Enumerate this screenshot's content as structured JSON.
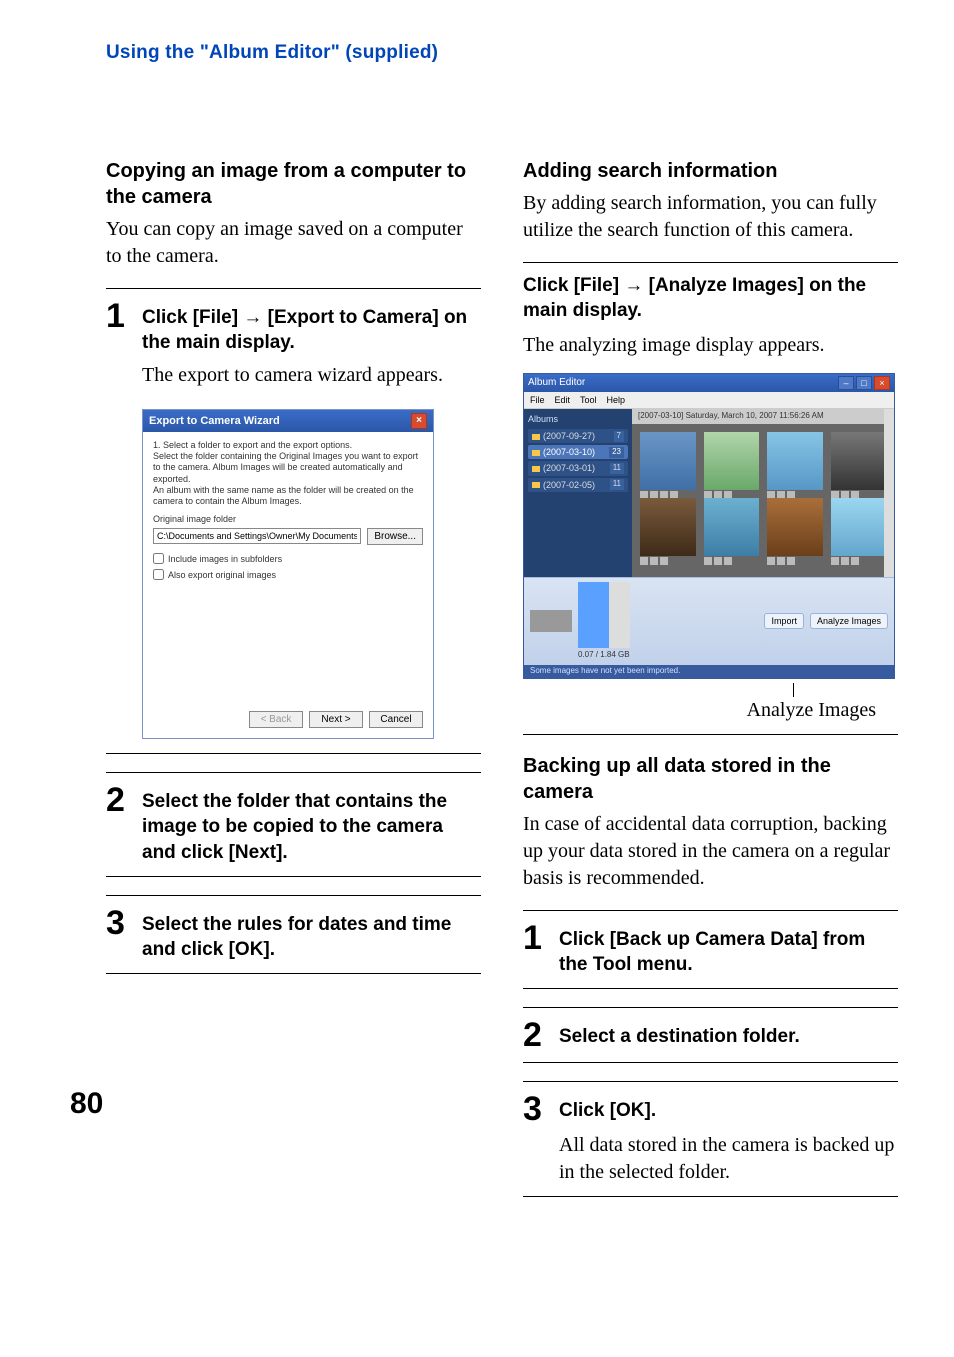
{
  "header": {
    "running": "Using the \"Album Editor\" (supplied)"
  },
  "page_number": "80",
  "left": {
    "section1": {
      "title": "Copying an image from a computer to the camera",
      "intro": "You can copy an image saved on a computer to the camera.",
      "steps": {
        "s1": {
          "num": "1",
          "title": "Click [File] → [Export to Camera] on the main display.",
          "body": "The export to camera wizard appears."
        },
        "s2": {
          "num": "2",
          "title": "Select the folder that contains the image to be copied to the camera and click [Next]."
        },
        "s3": {
          "num": "3",
          "title": "Select the rules for dates and time and click [OK]."
        }
      }
    },
    "wizard": {
      "title": "Export to Camera Wizard",
      "instruction": "1. Select a folder to export and the export options.\nSelect the folder containing the Original Images you want to export to the camera. Album Images will be created automatically and exported.\nAn album with the same name as the folder will be created on the camera to contain the Album Images.",
      "label": "Original image folder",
      "path_value": "C:\\Documents and Settings\\Owner\\My Documents\\My Pictures",
      "browse": "Browse...",
      "chk1": "Include images in subfolders",
      "chk2": "Also export original images",
      "back": "< Back",
      "next": "Next >",
      "cancel": "Cancel"
    }
  },
  "right": {
    "section1": {
      "title": "Adding search information",
      "intro": "By adding search information, you can fully utilize the search function of this camera.",
      "stepA": {
        "title": "Click [File] → [Analyze Images] on the main display.",
        "body": "The analyzing image display appears."
      },
      "pointer": "Analyze Images"
    },
    "app": {
      "title": "Album Editor",
      "menu": {
        "file": "File",
        "edit": "Edit",
        "tool": "Tool",
        "help": "Help"
      },
      "side": {
        "header": "Albums",
        "items": [
          {
            "label": "(2007-09-27)",
            "count": "7"
          },
          {
            "label": "(2007-03-10)",
            "count": "23"
          },
          {
            "label": "(2007-03-01)",
            "count": "11"
          },
          {
            "label": "(2007-02-05)",
            "count": "11"
          }
        ]
      },
      "path": "[2007-03-10] Saturday, March 10, 2007 11:56:26 AM",
      "bottom": {
        "cap": "0.07 / 1.84 GB",
        "import": "Import",
        "analyze": "Analyze Images"
      },
      "status": "Some images have not yet been imported."
    },
    "section2": {
      "title": "Backing up all data stored in the camera",
      "intro": "In case of accidental data corruption, backing up your data stored in the camera on a regular basis is recommended.",
      "s1": {
        "num": "1",
        "title": "Click [Back up Camera Data] from the Tool menu."
      },
      "s2": {
        "num": "2",
        "title": "Select a destination folder."
      },
      "s3": {
        "num": "3",
        "title": "Click [OK].",
        "body": "All data stored in the camera is backed up in the selected folder."
      }
    }
  }
}
